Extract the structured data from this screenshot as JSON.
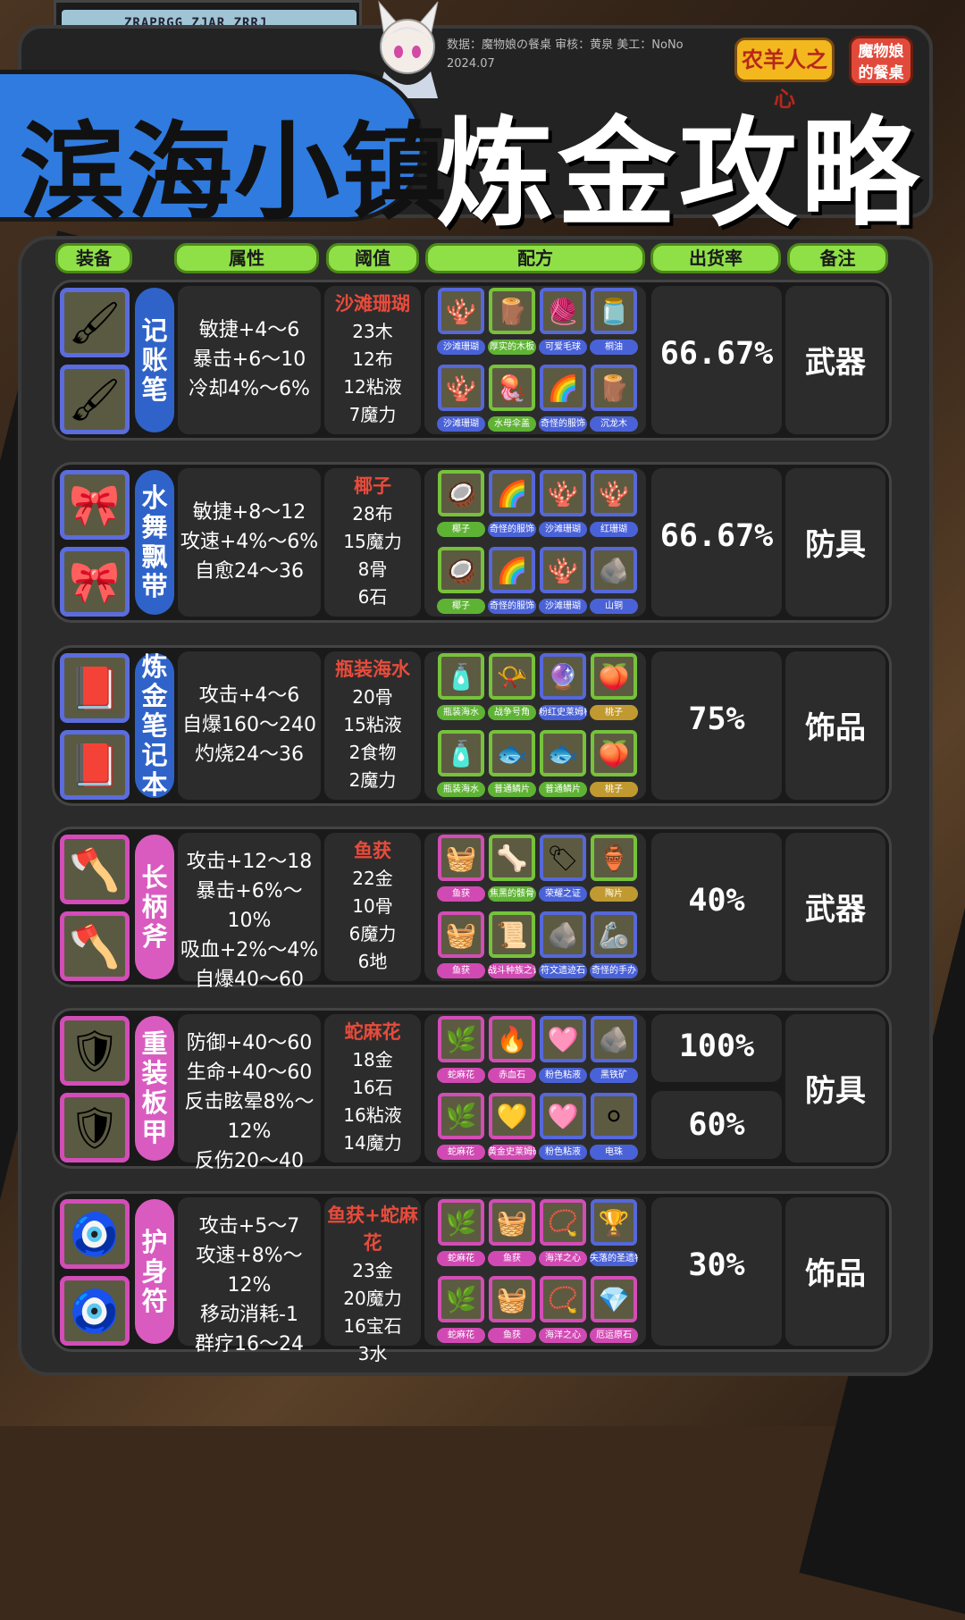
{
  "header": {
    "top_strip_text": "ZRAPRGG ZJAR ZRRJ",
    "town": "滨海小镇",
    "title": "炼金攻略",
    "credit_line1": "数据：魔物娘の餐桌  审核：黄泉  美工：NoNo",
    "credit_line2": "2024.07",
    "logo1_text": "农羊人之心",
    "logo2_text": "魔物娘的餐桌"
  },
  "columns": [
    "装备",
    "属性",
    "阈值",
    "配方",
    "出货率",
    "备注"
  ],
  "rows": [
    {
      "frame": "blue",
      "icon": "🖌",
      "name": "记账笔",
      "attrs": [
        "敏捷+4～6",
        "暴击+6～10",
        "冷却4%～6%"
      ],
      "key": "沙滩珊瑚",
      "thresholds": [
        "23木",
        "12布",
        "12粘液",
        "7魔力"
      ],
      "recipes": [
        {
          "icon": "🪸",
          "border": "b",
          "label": "沙滩珊瑚",
          "lc": "b"
        },
        {
          "icon": "🪵",
          "border": "g",
          "label": "厚实的木板",
          "lc": "g"
        },
        {
          "icon": "🧶",
          "border": "b",
          "label": "可爱毛球",
          "lc": "b"
        },
        {
          "icon": "🫙",
          "border": "b",
          "label": "桐油",
          "lc": "b"
        },
        {
          "icon": "🪸",
          "border": "b",
          "label": "沙滩珊瑚",
          "lc": "b"
        },
        {
          "icon": "🪼",
          "border": "g",
          "label": "水母伞盖",
          "lc": "g"
        },
        {
          "icon": "🌈",
          "border": "b",
          "label": "奇怪的服饰",
          "lc": "b"
        },
        {
          "icon": "🪵",
          "border": "b",
          "label": "沉龙木",
          "lc": "b"
        }
      ],
      "rates": [
        "66.67%"
      ],
      "note": "武器"
    },
    {
      "frame": "blue",
      "icon": "🎀",
      "name": "水舞飘带",
      "attrs": [
        "敏捷+8～12",
        "攻速+4%～6%",
        "自愈24～36"
      ],
      "key": "椰子",
      "thresholds": [
        "28布",
        "15魔力",
        "8骨",
        "6石"
      ],
      "recipes": [
        {
          "icon": "🥥",
          "border": "g",
          "label": "椰子",
          "lc": "g"
        },
        {
          "icon": "🌈",
          "border": "b",
          "label": "奇怪的服饰",
          "lc": "b"
        },
        {
          "icon": "🪸",
          "border": "b",
          "label": "沙滩珊瑚",
          "lc": "b"
        },
        {
          "icon": "🪸",
          "border": "b",
          "label": "红珊瑚",
          "lc": "b"
        },
        {
          "icon": "🥥",
          "border": "g",
          "label": "椰子",
          "lc": "g"
        },
        {
          "icon": "🌈",
          "border": "b",
          "label": "奇怪的服饰",
          "lc": "b"
        },
        {
          "icon": "🪸",
          "border": "b",
          "label": "沙滩珊瑚",
          "lc": "b"
        },
        {
          "icon": "🪨",
          "border": "b",
          "label": "山铜",
          "lc": "b"
        }
      ],
      "rates": [
        "66.67%"
      ],
      "note": "防具"
    },
    {
      "frame": "blue",
      "icon": "📕",
      "name": "炼金笔记本",
      "attrs": [
        "攻击+4～6",
        "自爆160～240",
        "灼烧24～36"
      ],
      "key": "瓶装海水",
      "thresholds": [
        "20骨",
        "15粘液",
        "2食物",
        "2魔力"
      ],
      "recipes": [
        {
          "icon": "🧴",
          "border": "g",
          "label": "瓶装海水",
          "lc": "g"
        },
        {
          "icon": "📯",
          "border": "g",
          "label": "战争号角",
          "lc": "g"
        },
        {
          "icon": "🔮",
          "border": "b",
          "label": "粉红史莱姆核晶",
          "lc": "b"
        },
        {
          "icon": "🍑",
          "border": "g",
          "label": "桃子",
          "lc": "y"
        },
        {
          "icon": "🧴",
          "border": "g",
          "label": "瓶装海水",
          "lc": "g"
        },
        {
          "icon": "🐟",
          "border": "g",
          "label": "普通鳞片",
          "lc": "g"
        },
        {
          "icon": "🐟",
          "border": "g",
          "label": "普通鳞片",
          "lc": "g"
        },
        {
          "icon": "🍑",
          "border": "g",
          "label": "桃子",
          "lc": "y"
        }
      ],
      "rates": [
        "75%"
      ],
      "note": "饰品"
    },
    {
      "frame": "pink",
      "icon": "🪓",
      "name": "长柄斧",
      "attrs": [
        "攻击+12～18",
        "暴击+6%～10%",
        "吸血+2%～4%",
        "自爆40～60"
      ],
      "key": "鱼获",
      "thresholds": [
        "22金",
        "10骨",
        "6魔力",
        "6地"
      ],
      "recipes": [
        {
          "icon": "🧺",
          "border": "p",
          "label": "鱼获",
          "lc": "p"
        },
        {
          "icon": "🦴",
          "border": "g",
          "label": "焦黑的骸骨",
          "lc": "g"
        },
        {
          "icon": "🏷",
          "border": "b",
          "label": "荣耀之证",
          "lc": "b"
        },
        {
          "icon": "🏺",
          "border": "g",
          "label": "陶片",
          "lc": "y"
        },
        {
          "icon": "🧺",
          "border": "p",
          "label": "鱼获",
          "lc": "p"
        },
        {
          "icon": "📜",
          "border": "g",
          "label": "战斗种族之证",
          "lc": "p"
        },
        {
          "icon": "🪨",
          "border": "b",
          "label": "符文遗迹石",
          "lc": "b"
        },
        {
          "icon": "🦾",
          "border": "b",
          "label": "奇怪的手办",
          "lc": "b"
        }
      ],
      "rates": [
        "40%"
      ],
      "note": "武器"
    },
    {
      "frame": "pink",
      "icon": "🛡",
      "name": "重装板甲",
      "attrs": [
        "防御+40～60",
        "生命+40～60",
        "反击眩晕8%～12%",
        "反伤20～40"
      ],
      "key": "蛇麻花",
      "thresholds": [
        "18金",
        "16石",
        "16粘液",
        "14魔力"
      ],
      "recipes": [
        {
          "icon": "🌿",
          "border": "p",
          "label": "蛇麻花",
          "lc": "p"
        },
        {
          "icon": "🔥",
          "border": "p",
          "label": "赤血石",
          "lc": "p"
        },
        {
          "icon": "🩷",
          "border": "b",
          "label": "粉色粘液",
          "lc": "b"
        },
        {
          "icon": "🪨",
          "border": "b",
          "label": "黑铁矿",
          "lc": "b"
        },
        {
          "icon": "🌿",
          "border": "p",
          "label": "蛇麻花",
          "lc": "p"
        },
        {
          "icon": "💛",
          "border": "p",
          "label": "黄金史莱姆碎片",
          "lc": "p"
        },
        {
          "icon": "🩷",
          "border": "b",
          "label": "粉色粘液",
          "lc": "b"
        },
        {
          "icon": "⚪",
          "border": "b",
          "label": "电珠",
          "lc": "b"
        }
      ],
      "rates": [
        "100%",
        "60%"
      ],
      "note": "防具"
    },
    {
      "frame": "pink",
      "icon": "🧿",
      "name": "护身符",
      "attrs": [
        "攻击+5～7",
        "攻速+8%～12%",
        "移动消耗-1",
        "群疗16～24"
      ],
      "key": "鱼获+蛇麻花",
      "thresholds": [
        "23金",
        "20魔力",
        "16宝石",
        "3水"
      ],
      "recipes": [
        {
          "icon": "🌿",
          "border": "p",
          "label": "蛇麻花",
          "lc": "p"
        },
        {
          "icon": "🧺",
          "border": "p",
          "label": "鱼获",
          "lc": "p"
        },
        {
          "icon": "📿",
          "border": "p",
          "label": "海洋之心",
          "lc": "p"
        },
        {
          "icon": "🏆",
          "border": "b",
          "label": "失落的圣遗物",
          "lc": "b"
        },
        {
          "icon": "🌿",
          "border": "p",
          "label": "蛇麻花",
          "lc": "p"
        },
        {
          "icon": "🧺",
          "border": "p",
          "label": "鱼获",
          "lc": "p"
        },
        {
          "icon": "📿",
          "border": "p",
          "label": "海洋之心",
          "lc": "p"
        },
        {
          "icon": "💎",
          "border": "p",
          "label": "厄运原石",
          "lc": "p"
        }
      ],
      "rates": [
        "30%"
      ],
      "note": "饰品"
    }
  ]
}
